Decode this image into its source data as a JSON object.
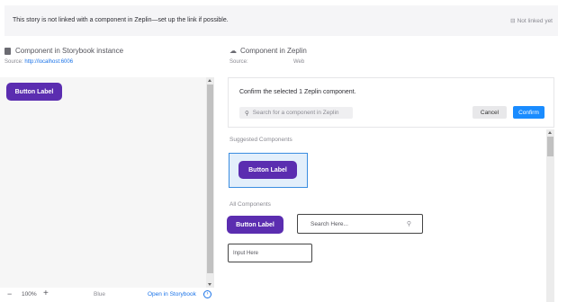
{
  "banner": {
    "message": "This story is not linked with a component in Zeplin—set up the link if possible.",
    "status": "Not linked yet",
    "status_icon": "link-off-icon"
  },
  "storybook": {
    "title": "Component in Storybook instance",
    "source_label": "Source:",
    "source_url": "http://localhost:6006",
    "button_label": "Button Label"
  },
  "footer": {
    "zoom_minus": "−",
    "zoom": "100%",
    "zoom_plus": "+",
    "background": "Blue",
    "open_label": "Open in Storybook"
  },
  "zeplin": {
    "title": "Component in Zeplin",
    "source_label": "Source:",
    "source_value": "Web",
    "confirm_text": "Confirm the selected 1 Zeplin component.",
    "search_placeholder": "Search for a component in Zeplin",
    "cancel_label": "Cancel",
    "confirm_label": "Confirm",
    "suggested_label": "Suggested Components",
    "suggested_button": "Button Label",
    "all_label": "All Components",
    "all_button": "Button Label",
    "search_here": "Search Here...",
    "input_here": "Input Here"
  },
  "colors": {
    "brand_purple": "#5b2db0",
    "accent_blue": "#1a8cff",
    "selected_bg": "#e3effb"
  }
}
